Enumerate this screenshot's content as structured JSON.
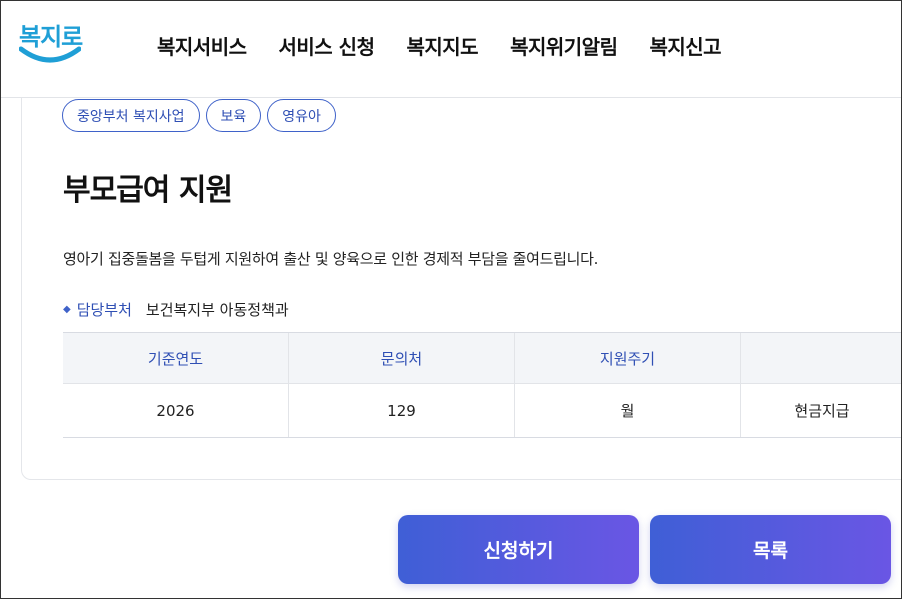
{
  "header": {
    "logo_text": "복지로",
    "nav": [
      "복지서비스",
      "서비스 신청",
      "복지지도",
      "복지위기알림",
      "복지신고"
    ]
  },
  "tags": [
    "중앙부처 복지사업",
    "보육",
    "영유아"
  ],
  "service": {
    "title": "부모급여 지원",
    "description": "영아기 집중돌봄을 두텁게 지원하여 출산 및 양육으로 인한 경제적 부담을 줄여드립니다.",
    "dept_label": "담당부처",
    "dept_value": "보건복지부 아동정책과"
  },
  "table": {
    "headers": [
      "기준연도",
      "문의처",
      "지원주기",
      ""
    ],
    "rows": [
      [
        "2026",
        "129",
        "월",
        "현금지급"
      ]
    ]
  },
  "buttons": {
    "apply": "신청하기",
    "list": "목록"
  },
  "colors": {
    "accent": "#3f62c9",
    "logo": "#1f9fd6",
    "button_start": "#3f5fd6",
    "button_end": "#6a56e4"
  }
}
